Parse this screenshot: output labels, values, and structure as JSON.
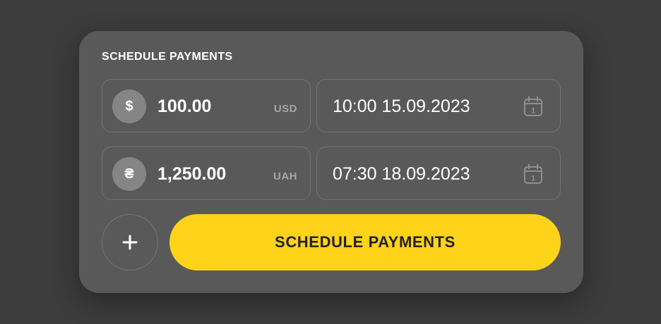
{
  "panel": {
    "title": "SCHEDULE PAYMENTS"
  },
  "payments": [
    {
      "currency_symbol": "$",
      "amount": "100.00",
      "currency_code": "USD",
      "datetime": "10:00 15.09.2023",
      "calendar_day": "1"
    },
    {
      "currency_symbol": "₴",
      "amount": "1,250.00",
      "currency_code": "UAH",
      "datetime": "07:30 18.09.2023",
      "calendar_day": "1"
    }
  ],
  "actions": {
    "add_symbol": "+",
    "schedule_label": "SCHEDULE PAYMENTS"
  },
  "colors": {
    "background": "#3c3c3c",
    "card": "#595959",
    "accent": "#ffd31a",
    "icon_circle": "#858585",
    "muted_text": "#a6a6a6"
  }
}
